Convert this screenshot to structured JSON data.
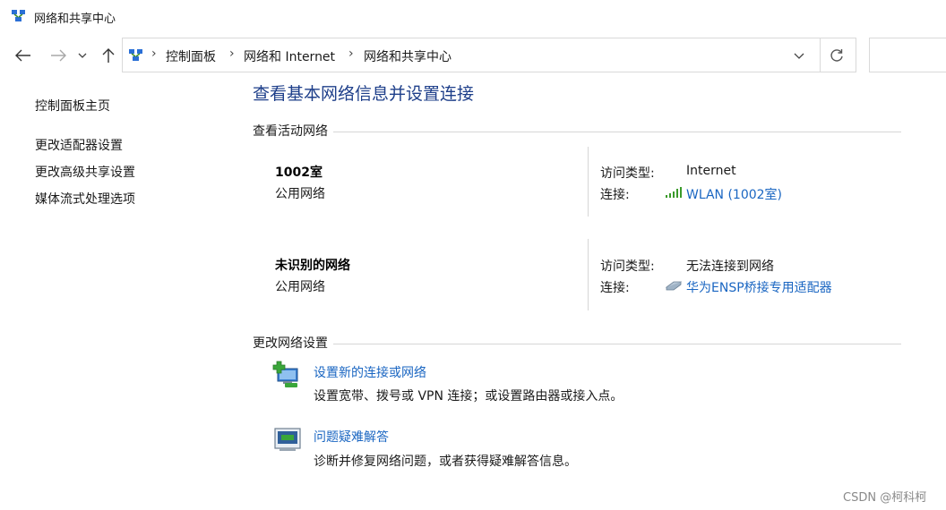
{
  "window": {
    "title": "网络和共享中心",
    "icon": "network-center-icon"
  },
  "address": {
    "crumbs": [
      "控制面板",
      "网络和 Internet",
      "网络和共享中心"
    ],
    "separator": "›",
    "icons": {
      "back": "arrow-left-icon",
      "forward": "arrow-right-icon",
      "recent": "chevron-down-icon",
      "up": "arrow-up-icon",
      "dropdown": "chevron-down-icon",
      "refresh": "refresh-icon"
    }
  },
  "sidebar": {
    "items": [
      {
        "label": "控制面板主页"
      },
      {
        "label": "更改适配器设置"
      },
      {
        "label": "更改高级共享设置"
      },
      {
        "label": "媒体流式处理选项"
      }
    ]
  },
  "main": {
    "title": "查看基本网络信息并设置连接",
    "active_networks_heading": "查看活动网络",
    "networks": [
      {
        "name": "1002室",
        "category": "公用网络",
        "access_label": "访问类型:",
        "access_value": "Internet",
        "connection_label": "连接:",
        "connection_value": "WLAN (1002室)",
        "connection_icon": "wifi-signal-icon"
      },
      {
        "name": "未识别的网络",
        "category": "公用网络",
        "access_label": "访问类型:",
        "access_value": "无法连接到网络",
        "connection_label": "连接:",
        "connection_value": "华为ENSP桥接专用适配器",
        "connection_icon": "ethernet-adapter-icon"
      }
    ],
    "change_heading": "更改网络设置",
    "tasks": [
      {
        "link": "设置新的连接或网络",
        "desc": "设置宽带、拨号或 VPN 连接；或设置路由器或接入点。",
        "icon": "new-connection-icon"
      },
      {
        "link": "问题疑难解答",
        "desc": "诊断并修复网络问题，或者获得疑难解答信息。",
        "icon": "troubleshoot-icon"
      }
    ]
  },
  "watermark": "CSDN @柯科柯",
  "colors": {
    "link": "#1a66c2",
    "title": "#1e3f8a"
  }
}
